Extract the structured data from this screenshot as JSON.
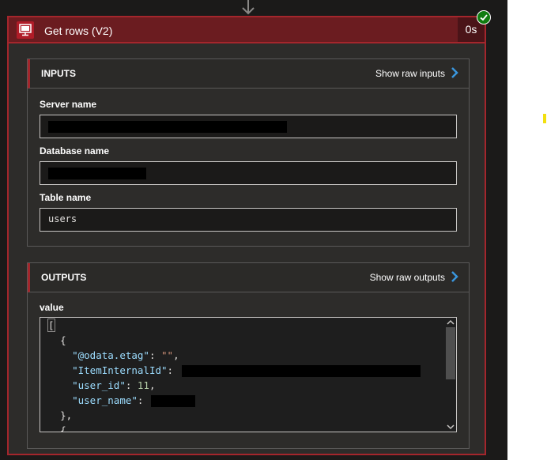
{
  "card": {
    "title": "Get rows (V2)",
    "duration": "0s",
    "icon": "sql-server-icon",
    "status": "succeeded"
  },
  "inputs": {
    "title": "INPUTS",
    "raw_link": "Show raw inputs",
    "fields": [
      {
        "label": "Server name",
        "value": ""
      },
      {
        "label": "Database name",
        "value": ""
      },
      {
        "label": "Table name",
        "value": "users"
      }
    ]
  },
  "outputs": {
    "title": "OUTPUTS",
    "raw_link": "Show raw outputs",
    "field_label": "value",
    "code": {
      "open_bracket": "[",
      "open_brace": "{",
      "etag_key": "\"@odata.etag\"",
      "etag_value": "\"\"",
      "item_key": "\"ItemInternalId\"",
      "user_id_key": "\"user_id\"",
      "user_id_value": "11",
      "user_name_key": "\"user_name\"",
      "close_brace": "},",
      "next_brace": "{"
    }
  },
  "colors": {
    "accent_red": "#a4262c",
    "success_green": "#107c10",
    "link_blue": "#3a96dd"
  }
}
